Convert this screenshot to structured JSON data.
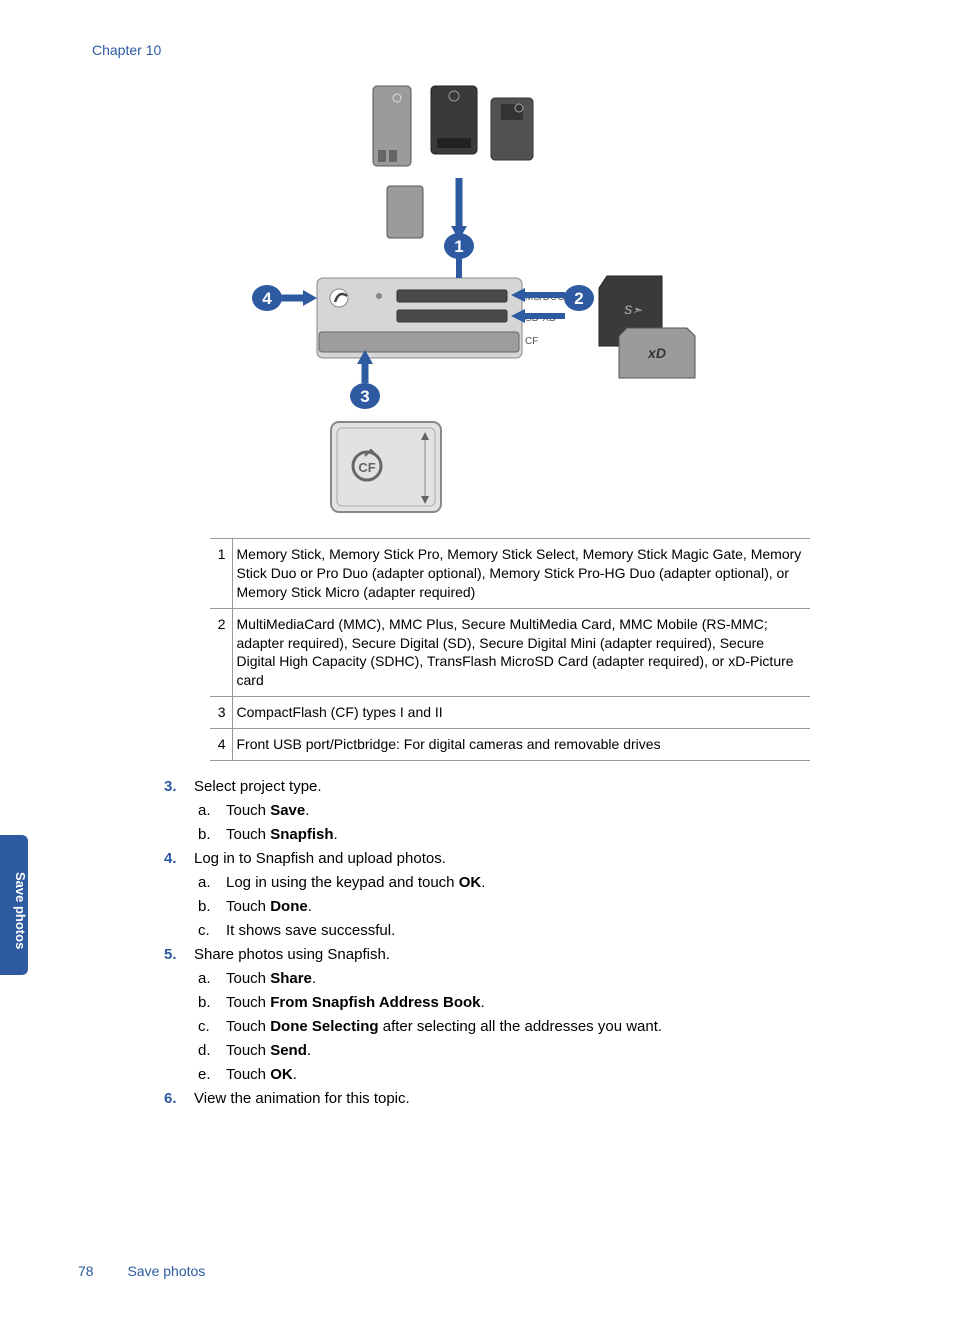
{
  "header": {
    "chapter": "Chapter 10"
  },
  "diagram": {
    "bubbles": {
      "b1": "1",
      "b2": "2",
      "b3": "3",
      "b4": "4"
    },
    "labels": {
      "msduo": "MS/DUO",
      "sdxd": "SD·XD",
      "cf": "CF"
    }
  },
  "legend": [
    {
      "n": "1",
      "text": "Memory Stick, Memory Stick Pro, Memory Stick Select, Memory Stick Magic Gate, Memory Stick Duo or Pro Duo (adapter optional), Memory Stick Pro-HG Duo (adapter optional), or Memory Stick Micro (adapter required)"
    },
    {
      "n": "2",
      "text": "MultiMediaCard (MMC), MMC Plus, Secure MultiMedia Card, MMC Mobile (RS-MMC; adapter required), Secure Digital (SD), Secure Digital Mini (adapter required), Secure Digital High Capacity (SDHC), TransFlash MicroSD Card (adapter required), or xD-Picture card"
    },
    {
      "n": "3",
      "text": "CompactFlash (CF) types I and II"
    },
    {
      "n": "4",
      "text": "Front USB port/Pictbridge: For digital cameras and removable drives"
    }
  ],
  "steps": {
    "s3": {
      "num": "3.",
      "text": "Select project type.",
      "subs": {
        "a": {
          "letter": "a",
          "pre": "Touch ",
          "bold": "Save",
          "post": "."
        },
        "b": {
          "letter": "b",
          "pre": "Touch ",
          "bold": "Snapfish",
          "post": "."
        }
      }
    },
    "s4": {
      "num": "4.",
      "text": "Log in to Snapfish and upload photos.",
      "subs": {
        "a": {
          "letter": "a",
          "pre": "Log in using the keypad and touch ",
          "bold": "OK",
          "post": "."
        },
        "b": {
          "letter": "b",
          "pre": "Touch ",
          "bold": "Done",
          "post": "."
        },
        "c": {
          "letter": "c",
          "pre": "It shows save successful.",
          "bold": "",
          "post": ""
        }
      }
    },
    "s5": {
      "num": "5.",
      "text": "Share photos using Snapfish.",
      "subs": {
        "a": {
          "letter": "a",
          "pre": "Touch ",
          "bold": "Share",
          "post": "."
        },
        "b": {
          "letter": "b",
          "pre": "Touch ",
          "bold": "From Snapfish Address Book",
          "post": "."
        },
        "c": {
          "letter": "c",
          "pre": "Touch ",
          "bold": "Done Selecting",
          "post": " after selecting all the addresses you want."
        },
        "d": {
          "letter": "d",
          "pre": "Touch ",
          "bold": "Send",
          "post": "."
        },
        "e": {
          "letter": "e",
          "pre": "Touch ",
          "bold": "OK",
          "post": "."
        }
      }
    },
    "s6": {
      "num": "6.",
      "text": "View the animation for this topic."
    }
  },
  "side_tab": "Save photos",
  "footer": {
    "page": "78",
    "title": "Save photos"
  }
}
